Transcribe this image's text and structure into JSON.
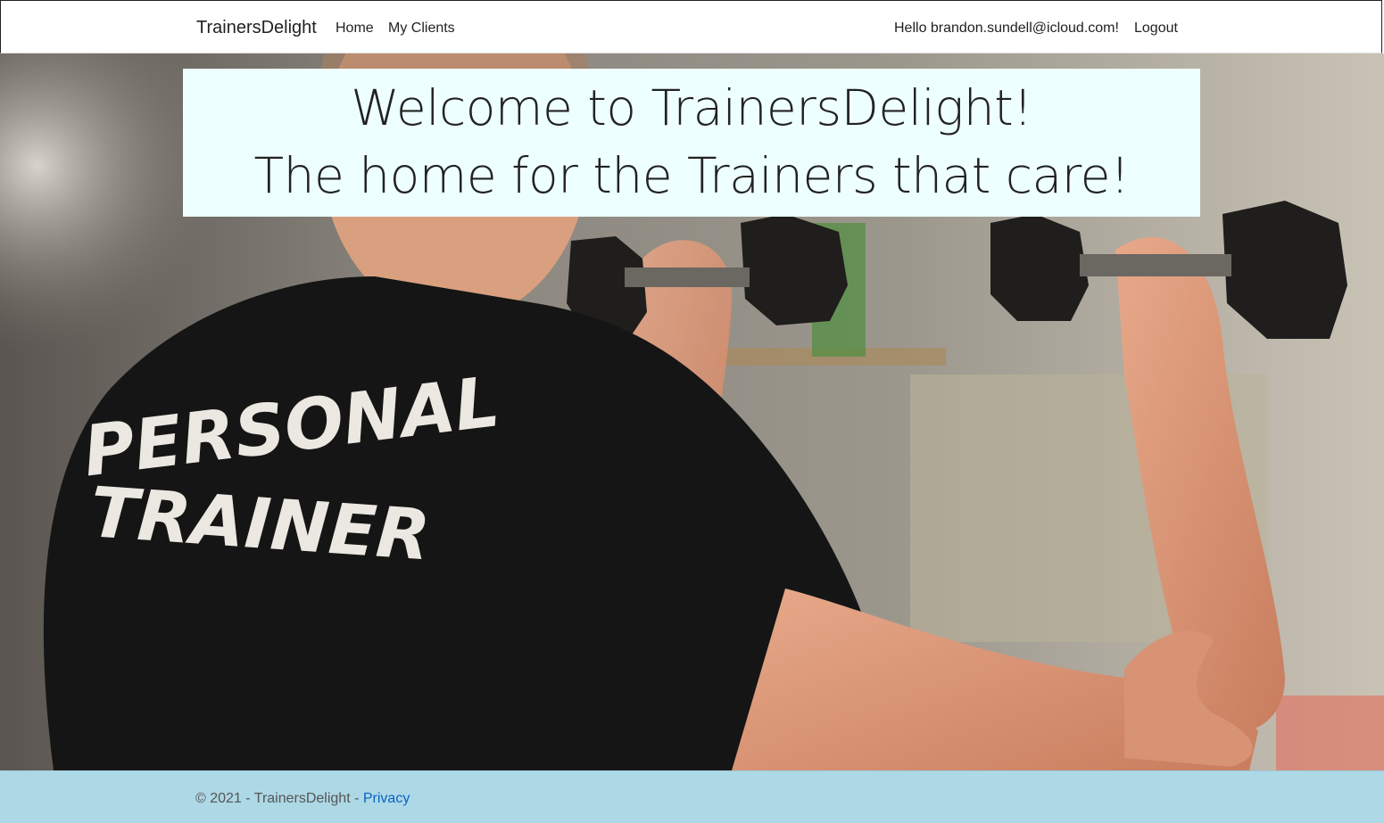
{
  "navbar": {
    "brand": "TrainersDelight",
    "links": [
      {
        "label": "Home"
      },
      {
        "label": "My Clients"
      }
    ],
    "greeting": "Hello brandon.sundell@icloud.com!",
    "logout": "Logout"
  },
  "hero": {
    "welcome_line1": "Welcome to TrainersDelight!",
    "welcome_line2": "The home for the Trainers that care!",
    "shirt_text": [
      "PERSONAL",
      "TRAINER"
    ],
    "image": "personal-trainer-gym-photo"
  },
  "footer": {
    "copyright": "© 2021 - TrainersDelight - ",
    "privacy": "Privacy"
  },
  "colors": {
    "welcome_bg": "#eeffff",
    "footer_bg": "#add8e6",
    "link": "#0b63c5"
  }
}
